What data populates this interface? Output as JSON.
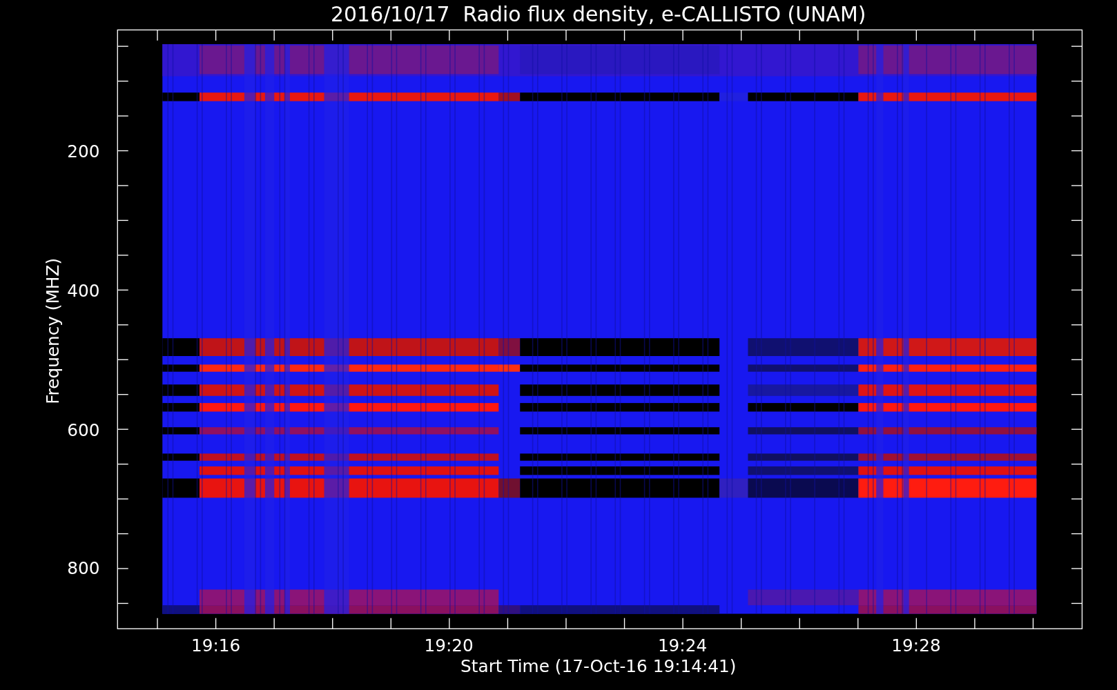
{
  "title": "2016/10/17  Radio flux density, e-CALLISTO (UNAM)",
  "plot": {
    "ylabel": "Frequency (MHZ)",
    "xlabel": "Start Time (17-Oct-16 19:14:41)",
    "yticks": [
      "200",
      "400",
      "600",
      "800"
    ],
    "xticks": [
      "19:16",
      "19:20",
      "19:24",
      "19:28"
    ]
  }
}
